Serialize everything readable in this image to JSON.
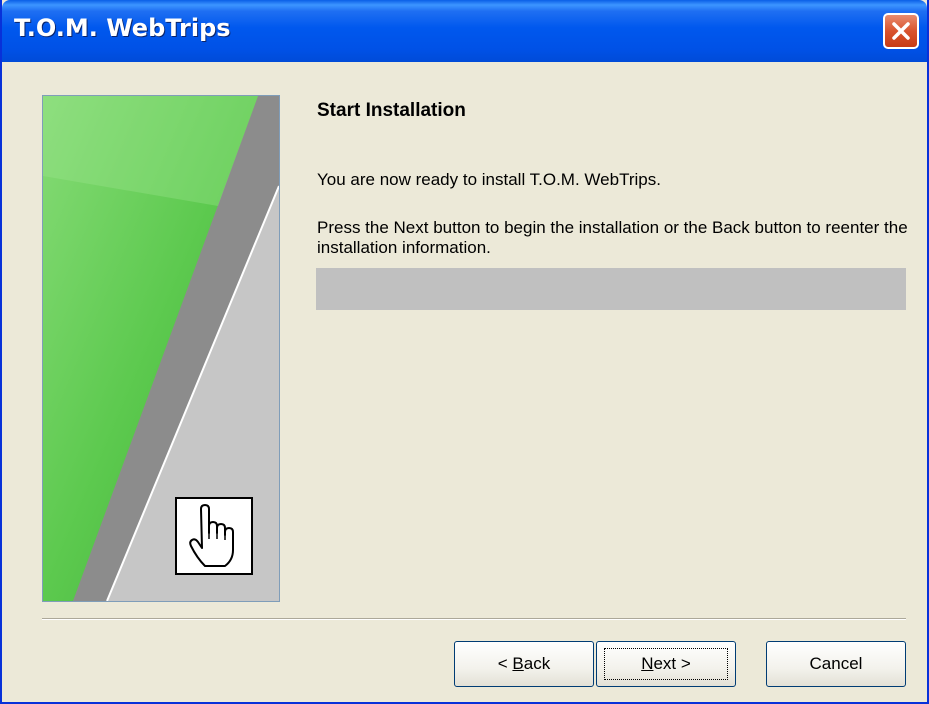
{
  "window": {
    "title": "T.O.M. WebTrips"
  },
  "content": {
    "heading": "Start Installation",
    "ready_text": "You are now ready to install T.O.M. WebTrips.",
    "instructions": "Press the Next button to begin the installation or the Back button to reenter the installation information."
  },
  "buttons": {
    "back_accel": "B",
    "back_rest": "ack",
    "back_prefix": "< ",
    "next_accel": "N",
    "next_rest": "ext >",
    "cancel": "Cancel"
  },
  "colors": {
    "titlebar": "#0054e3",
    "close_button": "#d9532e",
    "dialog_background": "#ece9d8",
    "banner_green": "#5cc94e",
    "progress_empty": "#c0c0c0"
  },
  "icons": [
    "close-icon",
    "pointing-hand-icon"
  ]
}
